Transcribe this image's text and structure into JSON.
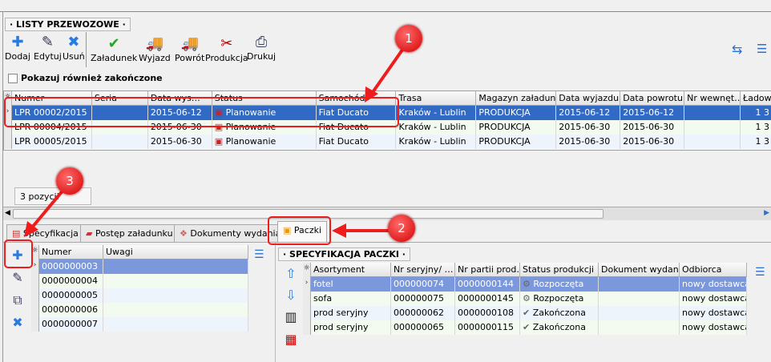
{
  "section_title": "LISTY PRZEWOZOWE",
  "toolbar": [
    {
      "label": "Dodaj",
      "icon": "plus-icon"
    },
    {
      "label": "Edytuj",
      "icon": "edit-icon"
    },
    {
      "label": "Usuń",
      "icon": "delete-icon"
    },
    {
      "label": "Załadunek",
      "icon": "loading-icon"
    },
    {
      "label": "Wyjazd",
      "icon": "truck-departure-icon"
    },
    {
      "label": "Powrót",
      "icon": "truck-return-icon"
    },
    {
      "label": "Produkcja",
      "icon": "production-icon"
    },
    {
      "label": "Drukuj",
      "icon": "print-icon"
    }
  ],
  "show_finished_label": "Pokazuj również zakończone",
  "main_grid": {
    "columns": [
      "Numer",
      "Seria",
      "Data wys…",
      "Status",
      "Samochód",
      "Trasa",
      "Magazyn załadunku",
      "Data wyjazdu",
      "Data powrotu",
      "Nr wewnęt…",
      "Ładown"
    ],
    "rows": [
      [
        "LPR 00002/2015",
        "",
        "2015-06-12",
        "Planowanie",
        "Fiat Ducato",
        "Kraków - Lublin",
        "PRODUKCJA",
        "2015-06-12",
        "2015-06-12",
        "",
        "1 3"
      ],
      [
        "LPR 00004/2015",
        "",
        "2015-06-30",
        "Planowanie",
        "Fiat Ducato",
        "Kraków - Lublin",
        "PRODUKCJA",
        "2015-06-30",
        "2015-06-30",
        "",
        "1 3"
      ],
      [
        "LPR 00005/2015",
        "",
        "2015-06-30",
        "Planowanie",
        "Fiat Ducato",
        "Kraków - Lublin",
        "PRODUKCJA",
        "2015-06-30",
        "2015-06-30",
        "",
        "1 3"
      ]
    ]
  },
  "count_label": "3 pozycji",
  "tabs": [
    "Specyfikacja",
    "Postęp załadunku",
    "Dokumenty wydania",
    "Paczki"
  ],
  "packages_grid": {
    "columns": [
      "Numer",
      "Uwagi"
    ],
    "rows": [
      [
        "0000000003",
        ""
      ],
      [
        "0000000004",
        ""
      ],
      [
        "0000000005",
        ""
      ],
      [
        "0000000006",
        ""
      ],
      [
        "0000000007",
        ""
      ]
    ]
  },
  "spec_title": "SPECYFIKACJA PACZKI",
  "spec_grid": {
    "columns": [
      "Asortyment",
      "Nr seryjny/ …",
      "Nr partii prod…",
      "Status produkcji",
      "Dokument wydania",
      "Odbiorca"
    ],
    "rows": [
      [
        "fotel",
        "000000074",
        "0000000144",
        "Rozpoczęta",
        "",
        "nowy dostawca"
      ],
      [
        "sofa",
        "000000075",
        "0000000145",
        "Rozpoczęta",
        "",
        "nowy dostawca"
      ],
      [
        "prod seryjny",
        "000000062",
        "0000000108",
        "Zakończona",
        "",
        "nowy dostawca"
      ],
      [
        "prod seryjny",
        "000000065",
        "0000000115",
        "Zakończona",
        "",
        "nowy dostawca"
      ]
    ]
  },
  "annotations": [
    "1",
    "2",
    "3"
  ],
  "colors": {
    "selection": "#316ac5",
    "annotation": "#ee1c1c"
  }
}
